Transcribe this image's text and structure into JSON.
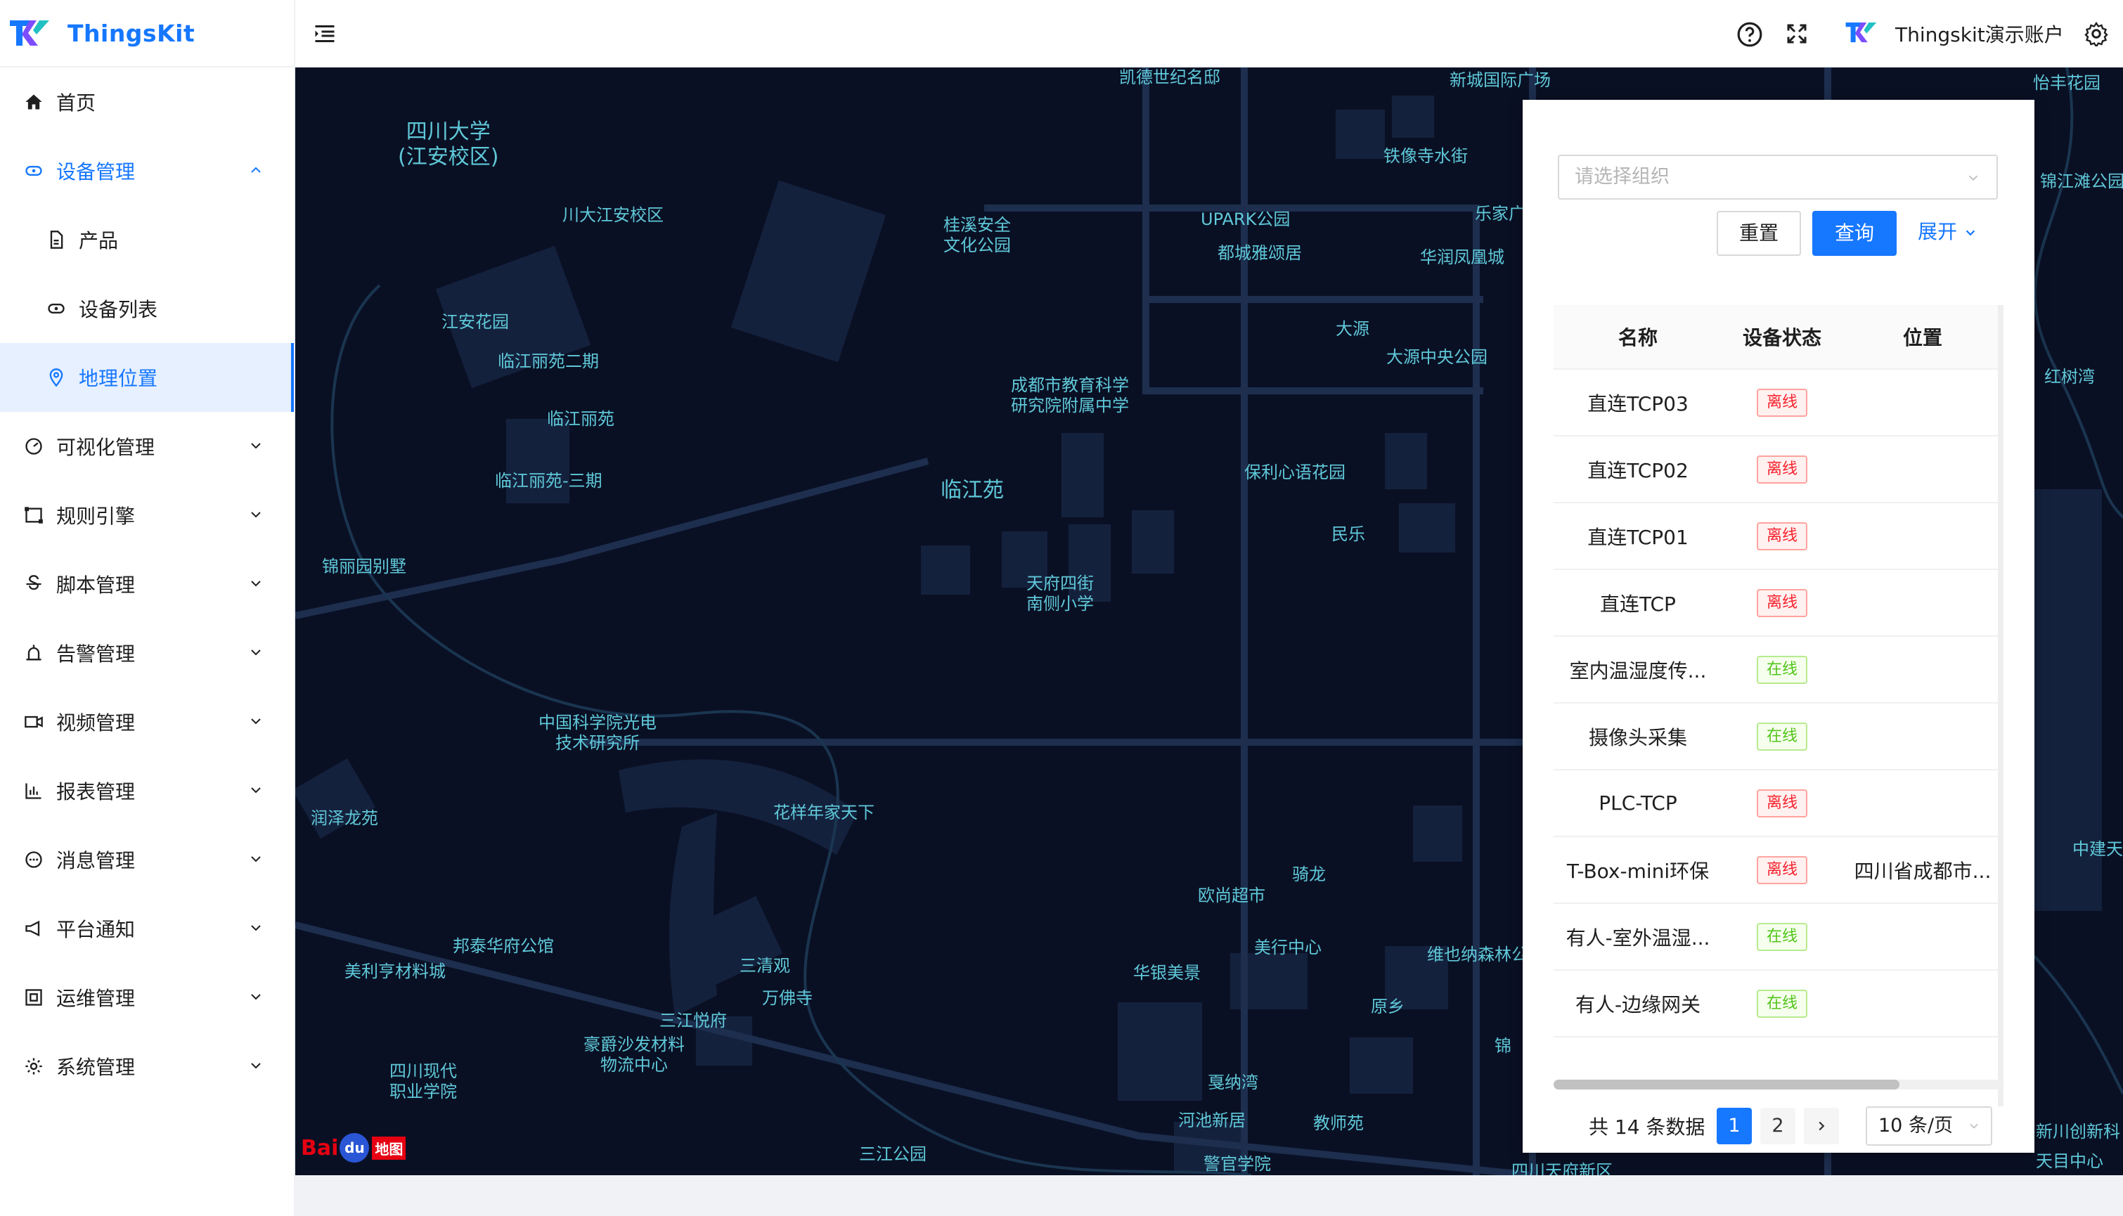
{
  "app": {
    "brand": "ThingsKit"
  },
  "sidebar": {
    "items": [
      {
        "label": "首页",
        "icon": "home-icon"
      },
      {
        "label": "设备管理",
        "icon": "device-icon"
      },
      {
        "label": "产品",
        "icon": "product-icon"
      },
      {
        "label": "设备列表",
        "icon": "device-list-icon"
      },
      {
        "label": "地理位置",
        "icon": "location-icon"
      },
      {
        "label": "可视化管理",
        "icon": "dashboard-icon"
      },
      {
        "label": "规则引擎",
        "icon": "rule-engine-icon"
      },
      {
        "label": "脚本管理",
        "icon": "script-icon"
      },
      {
        "label": "告警管理",
        "icon": "alarm-icon"
      },
      {
        "label": "视频管理",
        "icon": "video-icon"
      },
      {
        "label": "报表管理",
        "icon": "report-icon"
      },
      {
        "label": "消息管理",
        "icon": "message-icon"
      },
      {
        "label": "平台通知",
        "icon": "notification-icon"
      },
      {
        "label": "运维管理",
        "icon": "ops-icon"
      },
      {
        "label": "系统管理",
        "icon": "settings-icon"
      }
    ]
  },
  "header": {
    "account_name": "Thingskit演示账户"
  },
  "map": {
    "labels": [
      "凯德世纪名邸",
      "新城国际广场",
      "怡丰花园",
      "四川大学\n(江安校区)",
      "铁像寺水街",
      "川大江安校区",
      "桂溪安全\n文化公园",
      "UPARK公园",
      "乐家广",
      "都城雅颂居",
      "华润凤凰城",
      "锦江滩公园",
      "江安花园",
      "大源",
      "大源中央公园",
      "临江丽苑二期",
      "红树湾",
      "成都市教育科学\n研究院附属中学",
      "临江丽苑",
      "保利心语花园",
      "临江丽苑-三期",
      "临江苑",
      "民乐",
      "锦丽园别墅",
      "天府四街\n南侧小学",
      "中国科学院光电\n技术研究所",
      "花样年家天下",
      "润泽龙苑",
      "中建天",
      "骑龙",
      "欧尚超市",
      "邦泰华府公馆",
      "美行中心",
      "维也纳森林公",
      "美利亨材料城",
      "三清观",
      "华银美景",
      "万佛寺",
      "原乡",
      "三江悦府",
      "豪爵沙发材料\n物流中心",
      "锦",
      "四川现代\n职业学院",
      "戛纳湾",
      "河池新居",
      "教师苑",
      "新川创新科",
      "三江公园",
      "警官学院",
      "四川天府新区",
      "天目中心"
    ],
    "logo_text": "Baidu地图"
  },
  "filter": {
    "org_placeholder": "请选择组织",
    "reset_label": "重置",
    "query_label": "查询",
    "expand_label": "展开"
  },
  "table": {
    "columns": [
      "名称",
      "设备状态",
      "位置"
    ],
    "rows": [
      {
        "name": "直连TCP03",
        "status": "离线",
        "state": "off",
        "location": ""
      },
      {
        "name": "直连TCP02",
        "status": "离线",
        "state": "off",
        "location": ""
      },
      {
        "name": "直连TCP01",
        "status": "离线",
        "state": "off",
        "location": ""
      },
      {
        "name": "直连TCP",
        "status": "离线",
        "state": "off",
        "location": ""
      },
      {
        "name": "室内温湿度传...",
        "status": "在线",
        "state": "on",
        "location": ""
      },
      {
        "name": "摄像头采集",
        "status": "在线",
        "state": "on",
        "location": ""
      },
      {
        "name": "PLC-TCP",
        "status": "离线",
        "state": "off",
        "location": ""
      },
      {
        "name": "T-Box-mini环保",
        "status": "离线",
        "state": "off",
        "location": "四川省成都市..."
      },
      {
        "name": "有人-室外温湿...",
        "status": "在线",
        "state": "on",
        "location": ""
      },
      {
        "name": "有人-边缘网关",
        "status": "在线",
        "state": "on",
        "location": ""
      }
    ]
  },
  "pagination": {
    "total_text": "共 14 条数据",
    "pages": [
      "1",
      "2"
    ],
    "current": "1",
    "page_size": "10 条/页"
  },
  "colors": {
    "primary": "#1677ff",
    "map_bg": "#0a1024",
    "map_label": "#5fc8d8",
    "offline": "#f5222d",
    "online": "#52c41a"
  }
}
